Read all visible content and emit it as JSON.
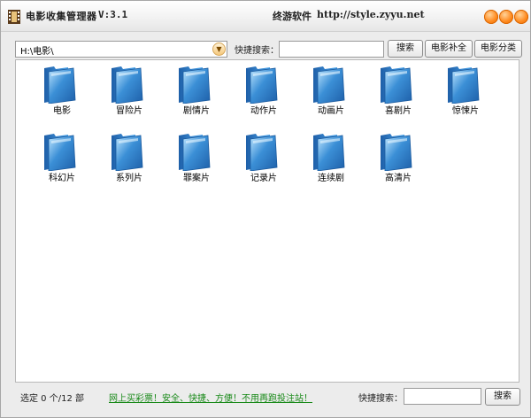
{
  "titlebar": {
    "title": "电影收集管理器",
    "version": "V:3.1",
    "brand": "终游软件",
    "url": "http://style.zyyu.net"
  },
  "toolbar": {
    "path": "H:\\电影\\",
    "quick_search_label": "快捷搜索：",
    "search_value": "",
    "search_button": "搜索",
    "supplement_button": "电影补全",
    "classify_button": "电影分类"
  },
  "folders": [
    {
      "label": "电影"
    },
    {
      "label": "冒险片"
    },
    {
      "label": "剧情片"
    },
    {
      "label": "动作片"
    },
    {
      "label": "动画片"
    },
    {
      "label": "喜剧片"
    },
    {
      "label": "惊悚片"
    },
    {
      "label": "科幻片"
    },
    {
      "label": "系列片"
    },
    {
      "label": "罪案片"
    },
    {
      "label": "记录片"
    },
    {
      "label": "连续剧"
    },
    {
      "label": "高清片"
    }
  ],
  "statusbar": {
    "count_text": "选定 0 个/12 部",
    "ad_link": "网上买彩票！安全、快捷、方便！不用再跑投注站！",
    "quick_search_label": "快捷搜索：",
    "search_value": "",
    "search_button": "搜索"
  },
  "colors": {
    "accent": "#ff8a1e",
    "link": "#1a8a1a",
    "folder": "#3b8fd6"
  }
}
